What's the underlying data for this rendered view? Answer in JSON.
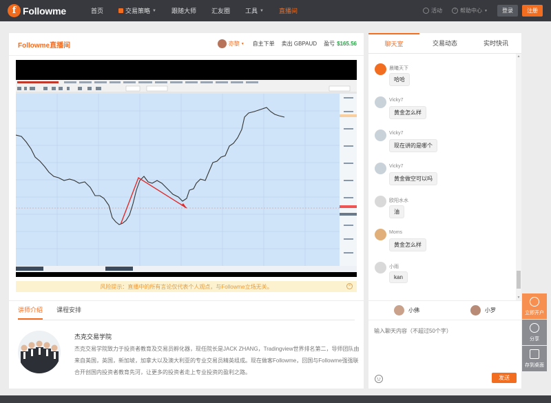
{
  "nav": {
    "logo_text": "Followme",
    "items": [
      {
        "label": "首页",
        "active": false,
        "dropdown": false
      },
      {
        "label": "交易策略",
        "active": false,
        "dropdown": true
      },
      {
        "label": "跟随大师",
        "active": false,
        "dropdown": false
      },
      {
        "label": "汇友圈",
        "active": false,
        "dropdown": false
      },
      {
        "label": "工具",
        "active": false,
        "dropdown": true
      },
      {
        "label": "直播间",
        "active": true,
        "dropdown": false
      }
    ],
    "activity": "活动",
    "help": "帮助中心",
    "login": "登录",
    "register": "注册"
  },
  "live": {
    "title": "Followme直播间",
    "host_name": "亦黎",
    "self_order": "自主下单",
    "sell": "卖出 GBPAUD",
    "profit_label": "盈亏",
    "profit_value": "$165.56",
    "warning": "风险提示：直播中的所有言论仅代表个人观点，与Followme立场无关。"
  },
  "chart_data": {
    "type": "line",
    "title": "",
    "x": [],
    "series": []
  },
  "intro": {
    "tabs": [
      "讲师介绍",
      "课程安排"
    ],
    "name": "杰克交易学院",
    "description": "杰克交易学院致力于投资者教育及交易员孵化器，现任院长是JACK ZHANG，Tradingview世界排名第二，导师团队由来自美国，英国，新加坡，加拿大以及澳大利亚的专业交易员精英组成。现在做客Followme，回国与Followme强强联合开创国内投资者教育先河，让更多的投资者走上专业投资的盈利之路。"
  },
  "chat": {
    "tabs": [
      "聊天室",
      "交易动态",
      "实时快讯"
    ],
    "messages": [
      {
        "user": "晨曦天下",
        "text": "哈哈",
        "avatar_color": "#f36d21"
      },
      {
        "user": "Vicky7",
        "text": "黄金怎么样",
        "avatar_color": "#c9d2d9"
      },
      {
        "user": "Vicky7",
        "text": "现在讲的是哪个",
        "avatar_color": "#c9d2d9"
      },
      {
        "user": "Vicky7",
        "text": "黄金做空可以吗",
        "avatar_color": "#c9d2d9"
      },
      {
        "user": "欧阳水水",
        "text": "油",
        "avatar_color": "#d9d9d9"
      },
      {
        "user": "Moms",
        "text": "黄金怎么样",
        "avatar_color": "#e1b07a"
      },
      {
        "user": "小雨",
        "text": "kan",
        "avatar_color": "#d9d9d9"
      }
    ],
    "assistants": [
      "小佛",
      "小罗"
    ],
    "input_placeholder": "输入聊天内容（不超过50个字）",
    "send": "发送"
  },
  "float_buttons": [
    "立即开户",
    "分享",
    "存到桌面"
  ]
}
